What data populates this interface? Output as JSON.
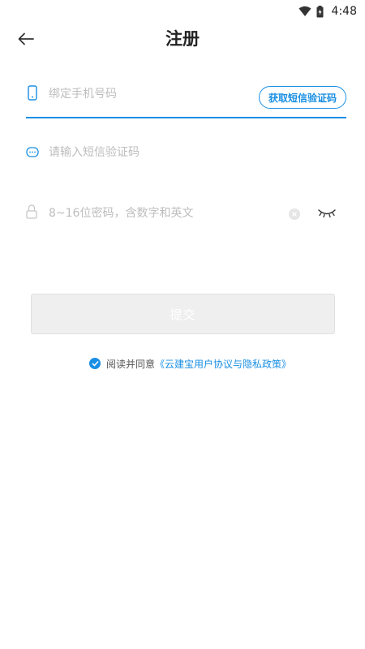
{
  "status_bar": {
    "time": "4:48"
  },
  "header": {
    "title": "注册"
  },
  "form": {
    "phone_placeholder": "绑定手机号码",
    "sms_button_label": "获取短信验证码",
    "code_placeholder": "请输入短信验证码",
    "password_placeholder": "8~16位密码，含数字和英文",
    "submit_label": "提交"
  },
  "agreement": {
    "prefix": "阅读并同意",
    "link": "《云建宝用户协议与隐私政策》",
    "checked": true
  },
  "colors": {
    "accent": "#1a8fe3",
    "button_disabled": "#efefef"
  }
}
